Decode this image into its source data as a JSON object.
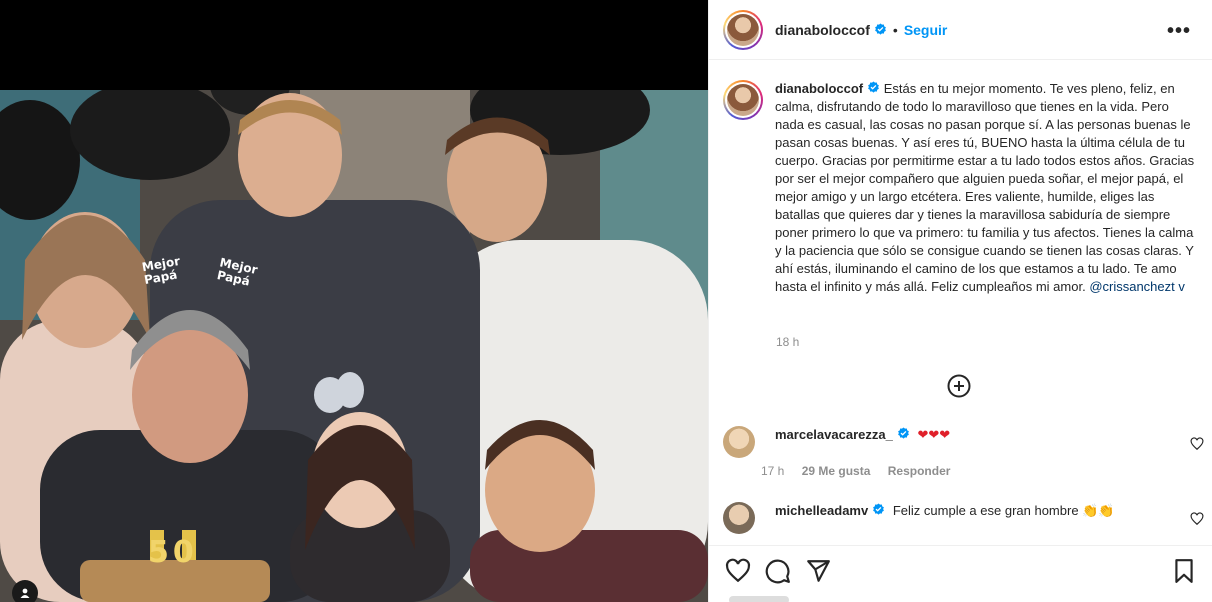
{
  "post": {
    "username": "dianaboloccof",
    "follow_label": "Seguir",
    "dot": "•",
    "more_label": "•••",
    "caption": "Estás en tu mejor momento. Te ves pleno, feliz, en calma, disfrutando de todo lo maravilloso que tienes en la vida. Pero nada es casual, las cosas no pasan porque sí. A las personas buenas le pasan cosas buenas. Y así eres tú, BUENO hasta la última célula de tu cuerpo. Gracias por permitirme estar a tu lado todos estos años. Gracias por ser el mejor compañero que alguien pueda soñar, el mejor papá, el mejor amigo y un largo etcétera. Eres valiente, humilde, eliges las batallas que quieres dar y tienes la maravillosa sabiduría de siempre poner primero lo que va primero: tu familia y tus afectos. Tienes la calma y la paciencia que sólo se consigue cuando se tienen las cosas claras. Y ahí estás, iluminando el camino de los que estamos a tu lado. Te amo hasta el infinito y más allá. Feliz cumpleaños mi amor.",
    "caption_mention": "@crissanchezt v",
    "time": "18 h",
    "photo_text": {
      "hat_left": "Mejor\nPapá",
      "hat_right": "Mejor\nPapá",
      "candles": "50"
    }
  },
  "comments": [
    {
      "username": "marcelavacarezza_",
      "text": "❤❤❤",
      "time": "17 h",
      "likes": "29 Me gusta",
      "reply": "Responder"
    },
    {
      "username": "michelleadamv",
      "text": "Feliz cumple a ese gran hombre 👏👏"
    }
  ],
  "icons": {
    "verified": "verified-badge-icon",
    "load_more": "plus-circle-icon",
    "like": "heart-icon",
    "comment": "comment-icon",
    "share": "paper-plane-icon",
    "save": "bookmark-icon"
  },
  "colors": {
    "accent": "#0095f6",
    "verified": "#0095f6",
    "heart": "#ed4956",
    "mention": "#00376b",
    "muted": "#8e8e8e"
  }
}
